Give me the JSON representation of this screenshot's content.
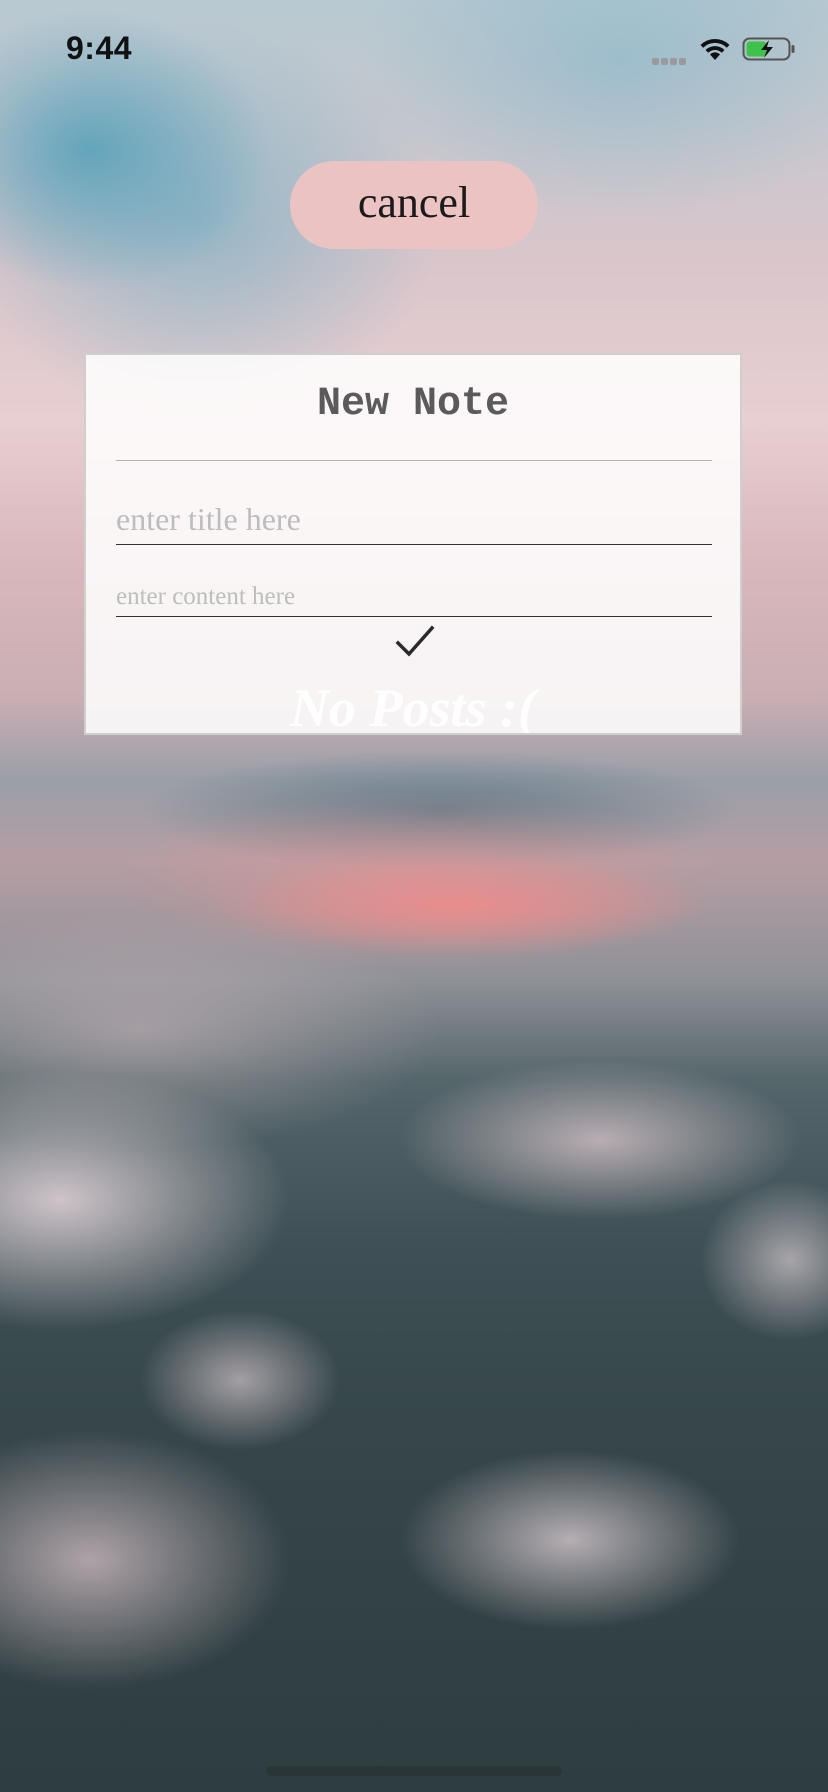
{
  "status_bar": {
    "time": "9:44",
    "signal_icon": "cellular-signal-icon",
    "wifi_icon": "wifi-icon",
    "battery_icon": "battery-charging-icon"
  },
  "cancel_button": {
    "label": "cancel",
    "color": "#ecc3c3"
  },
  "note_card": {
    "title": "New Note",
    "title_field": {
      "value": "",
      "placeholder": "enter title here"
    },
    "content_field": {
      "value": "",
      "placeholder": "enter content here"
    },
    "confirm_icon": "checkmark-icon"
  },
  "empty_state": {
    "message": "No Posts :("
  }
}
